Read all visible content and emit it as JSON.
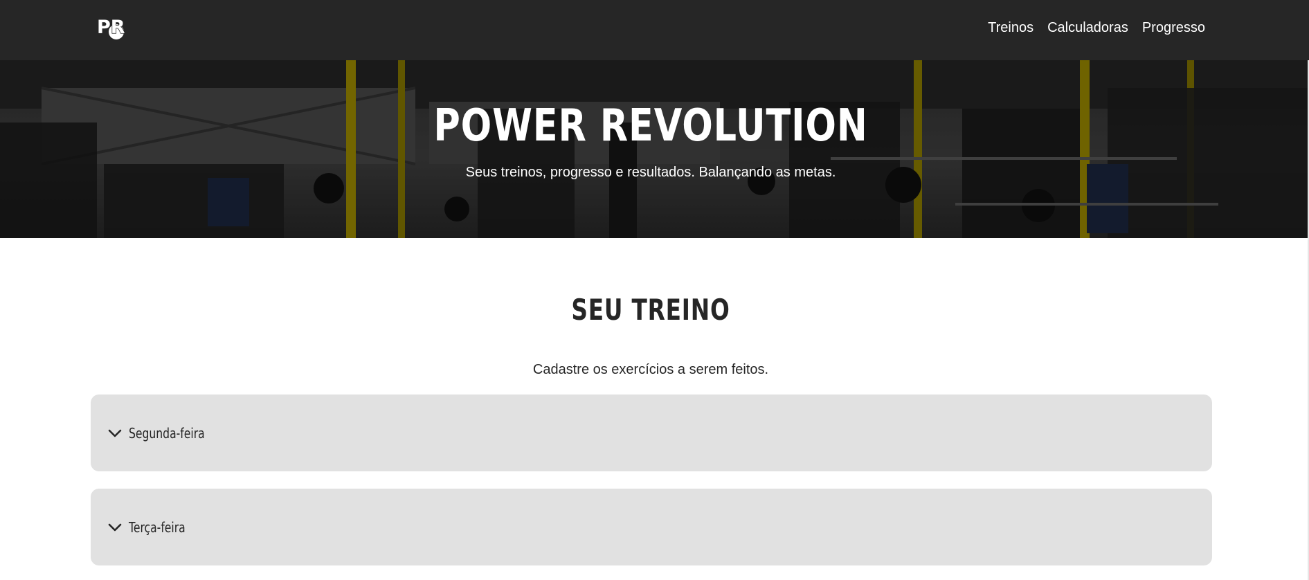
{
  "nav": {
    "logo_text": "PR",
    "links": [
      {
        "label": "Treinos"
      },
      {
        "label": "Calculadoras"
      },
      {
        "label": "Progresso"
      }
    ]
  },
  "hero": {
    "title": "POWER REVOLUTION",
    "subtitle": "Seus treinos, progresso e resultados. Balançando as metas."
  },
  "section": {
    "title": "SEU TREINO",
    "description": "Cadastre os exercícios a serem feitos."
  },
  "days": [
    {
      "label": "Segunda-feira",
      "icon": "chevron-down-icon"
    },
    {
      "label": "Terça-feira",
      "icon": "chevron-down-icon"
    }
  ],
  "colors": {
    "navbar": "#262626",
    "card": "#e1e1e1",
    "text": "#262626",
    "accent_yellow": "#c9b400"
  }
}
